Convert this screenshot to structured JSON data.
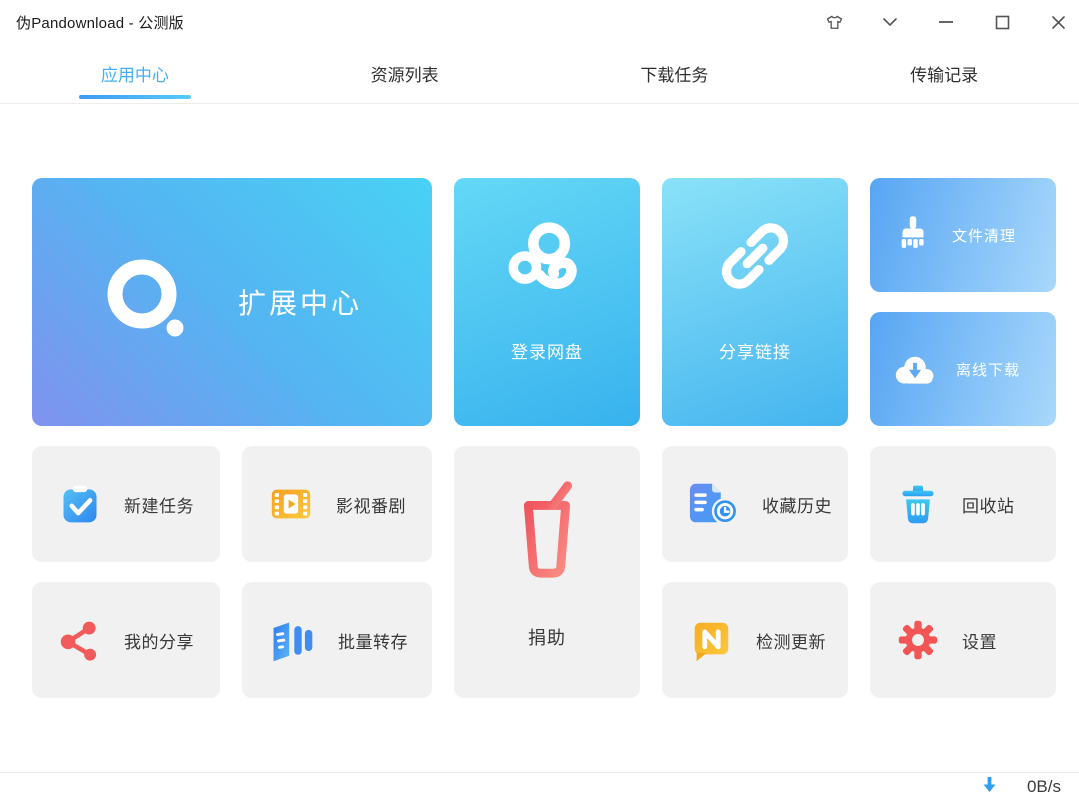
{
  "window": {
    "title": "伪Pandownload - 公测版",
    "controls": {
      "theme": "shirt-icon",
      "collapse": "chevron-down-icon",
      "minimize": "minimize-icon",
      "maximize": "maximize-icon",
      "close": "close-icon"
    }
  },
  "tabs": [
    {
      "label": "应用中心",
      "active": true
    },
    {
      "label": "资源列表",
      "active": false
    },
    {
      "label": "下载任务",
      "active": false
    },
    {
      "label": "传输记录",
      "active": false
    }
  ],
  "tiles": {
    "extension_center": {
      "label": "扩展中心",
      "icon": "ring-logo-icon"
    },
    "login_pan": {
      "label": "登录网盘",
      "icon": "baidu-cloud-icon"
    },
    "share_link": {
      "label": "分享链接",
      "icon": "chain-link-icon"
    },
    "file_cleanup": {
      "label": "文件清理",
      "icon": "broom-icon"
    },
    "offline_download": {
      "label": "离线下载",
      "icon": "cloud-download-icon"
    },
    "new_task": {
      "label": "新建任务",
      "icon": "clipboard-check-icon"
    },
    "video_series": {
      "label": "影视番剧",
      "icon": "film-play-icon"
    },
    "donate": {
      "label": "捐助",
      "icon": "drink-cup-icon"
    },
    "favorites_history": {
      "label": "收藏历史",
      "icon": "document-clock-icon"
    },
    "recycle_bin": {
      "label": "回收站",
      "icon": "trash-icon"
    },
    "my_shares": {
      "label": "我的分享",
      "icon": "share-nodes-icon"
    },
    "batch_transfer": {
      "label": "批量转存",
      "icon": "book-bars-icon"
    },
    "check_update": {
      "label": "检测更新",
      "icon": "n-badge-icon"
    },
    "settings": {
      "label": "设置",
      "icon": "gear-icon"
    }
  },
  "status_bar": {
    "download_speed": "0B/s"
  },
  "colors": {
    "accent": "#45aef5",
    "big_tile_start": "#8092ee",
    "big_tile_end": "#48d2f4",
    "light_blue_tile_start": "#57a5f3",
    "light_blue_tile_end": "#a8d8fb",
    "gray_tile": "#f1f1f2",
    "donate_red": "#f4626a"
  }
}
